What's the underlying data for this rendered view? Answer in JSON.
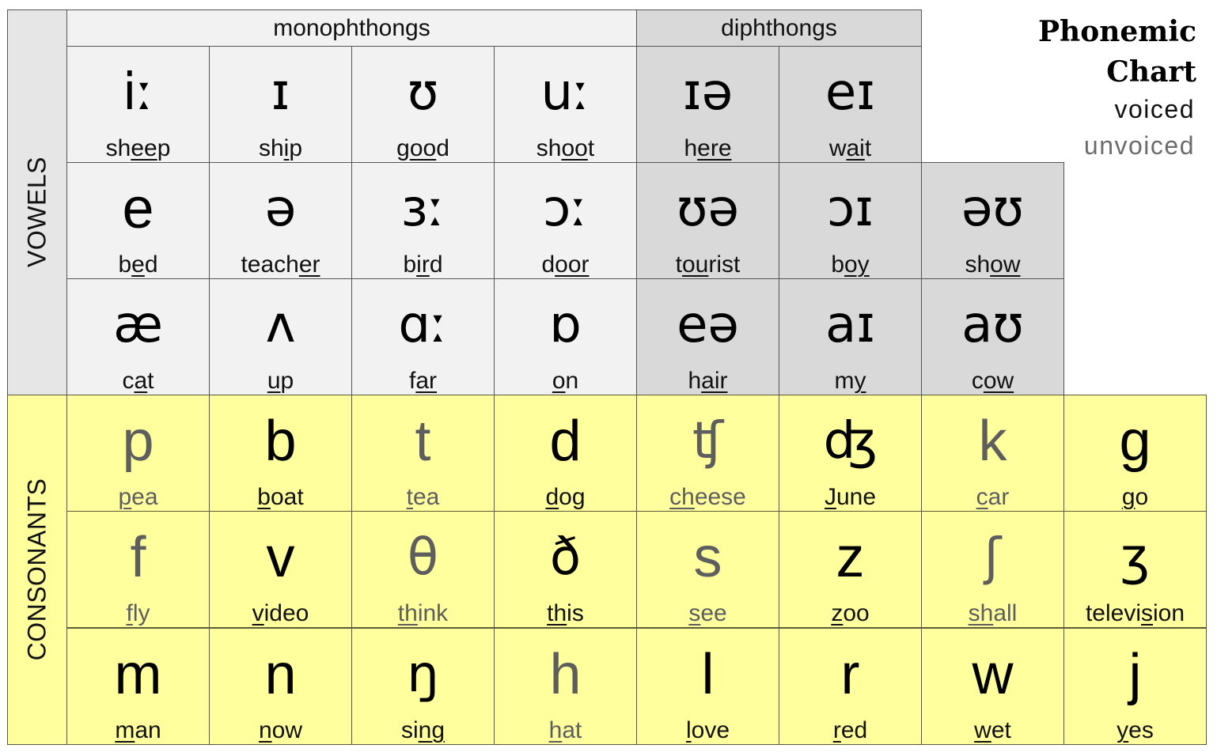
{
  "title": {
    "line1": "Phonemic",
    "line2": "Chart"
  },
  "legend": {
    "voiced": "voiced",
    "unvoiced": "unvoiced"
  },
  "colors": {
    "monophthong_bg": "#f2f2f2",
    "diphthong_bg": "#d9d9d9",
    "consonant_bg": "#ffff9e",
    "voiced_text": "#000000",
    "unvoiced_text": "#5e5e5e"
  },
  "sections": {
    "vowels": "VOWELS",
    "consonants": "CONSONANTS"
  },
  "headers": {
    "monophthongs": "monophthongs",
    "diphthongs": "diphthongs"
  },
  "vowels": [
    [
      {
        "symbol": "iː",
        "word": [
          "sh",
          "ee",
          "p"
        ],
        "type": "mono"
      },
      {
        "symbol": "ɪ",
        "word": [
          "sh",
          "i",
          "p"
        ],
        "type": "mono"
      },
      {
        "symbol": "ʊ",
        "word": [
          "g",
          "oo",
          "d"
        ],
        "type": "mono"
      },
      {
        "symbol": "uː",
        "word": [
          "sh",
          "oo",
          "t"
        ],
        "type": "mono"
      },
      {
        "symbol": "ɪə",
        "word": [
          "h",
          "ere",
          ""
        ],
        "type": "diph"
      },
      {
        "symbol": "eɪ",
        "word": [
          "w",
          "ai",
          "t"
        ],
        "type": "diph"
      }
    ],
    [
      {
        "symbol": "e",
        "word": [
          "b",
          "e",
          "d"
        ],
        "type": "mono"
      },
      {
        "symbol": "ə",
        "word": [
          "teach",
          "er",
          ""
        ],
        "type": "mono"
      },
      {
        "symbol": "ɜː",
        "word": [
          "b",
          "ir",
          "d"
        ],
        "type": "mono"
      },
      {
        "symbol": "ɔː",
        "word": [
          "d",
          "oor",
          ""
        ],
        "type": "mono"
      },
      {
        "symbol": "ʊə",
        "word": [
          "t",
          "ou",
          "rist"
        ],
        "type": "diph"
      },
      {
        "symbol": "ɔɪ",
        "word": [
          "b",
          "oy",
          ""
        ],
        "type": "diph"
      },
      {
        "symbol": "əʊ",
        "word": [
          "sh",
          "ow",
          ""
        ],
        "type": "diph"
      }
    ],
    [
      {
        "symbol": "æ",
        "word": [
          "c",
          "a",
          "t"
        ],
        "type": "mono"
      },
      {
        "symbol": "ʌ",
        "word": [
          "",
          "u",
          "p"
        ],
        "type": "mono"
      },
      {
        "symbol": "ɑː",
        "word": [
          "f",
          "ar",
          ""
        ],
        "type": "mono"
      },
      {
        "symbol": "ɒ",
        "word": [
          "",
          "o",
          "n"
        ],
        "type": "mono"
      },
      {
        "symbol": "eə",
        "word": [
          "h",
          "air",
          ""
        ],
        "type": "diph"
      },
      {
        "symbol": "aɪ",
        "word": [
          "m",
          "y",
          ""
        ],
        "type": "diph"
      },
      {
        "symbol": "aʊ",
        "word": [
          "c",
          "ow",
          ""
        ],
        "type": "diph"
      }
    ]
  ],
  "consonants": [
    [
      {
        "symbol": "p",
        "word": [
          "",
          "p",
          "ea"
        ],
        "voiced": false
      },
      {
        "symbol": "b",
        "word": [
          "",
          "b",
          "oat"
        ],
        "voiced": true
      },
      {
        "symbol": "t",
        "word": [
          "",
          "t",
          "ea"
        ],
        "voiced": false
      },
      {
        "symbol": "d",
        "word": [
          "",
          "d",
          "og"
        ],
        "voiced": true
      },
      {
        "symbol": "ʧ",
        "word": [
          "",
          "ch",
          "eese"
        ],
        "voiced": false
      },
      {
        "symbol": "ʤ",
        "word": [
          "",
          "J",
          "une"
        ],
        "voiced": true
      },
      {
        "symbol": "k",
        "word": [
          "",
          "c",
          "ar"
        ],
        "voiced": false
      },
      {
        "symbol": "g",
        "word": [
          "",
          "g",
          "o"
        ],
        "voiced": true
      }
    ],
    [
      {
        "symbol": "f",
        "word": [
          "",
          "f",
          "ly"
        ],
        "voiced": false
      },
      {
        "symbol": "v",
        "word": [
          "",
          "v",
          "ideo"
        ],
        "voiced": true
      },
      {
        "symbol": "θ",
        "word": [
          "",
          "th",
          "ink"
        ],
        "voiced": false
      },
      {
        "symbol": "ð",
        "word": [
          "",
          "th",
          "is"
        ],
        "voiced": true
      },
      {
        "symbol": "s",
        "word": [
          "",
          "s",
          "ee"
        ],
        "voiced": false
      },
      {
        "symbol": "z",
        "word": [
          "",
          "z",
          "oo"
        ],
        "voiced": true
      },
      {
        "symbol": "ʃ",
        "word": [
          "",
          "sh",
          "all"
        ],
        "voiced": false
      },
      {
        "symbol": "ʒ",
        "word": [
          "televi",
          "s",
          "ion"
        ],
        "voiced": true
      }
    ],
    [
      {
        "symbol": "m",
        "word": [
          "",
          "m",
          "an"
        ],
        "voiced": true
      },
      {
        "symbol": "n",
        "word": [
          "",
          "n",
          "ow"
        ],
        "voiced": true
      },
      {
        "symbol": "ŋ",
        "word": [
          "si",
          "ng",
          ""
        ],
        "voiced": true
      },
      {
        "symbol": "h",
        "word": [
          "",
          "h",
          "at"
        ],
        "voiced": false
      },
      {
        "symbol": "l",
        "word": [
          "",
          "l",
          "ove"
        ],
        "voiced": true
      },
      {
        "symbol": "r",
        "word": [
          "",
          "r",
          "ed"
        ],
        "voiced": true
      },
      {
        "symbol": "w",
        "word": [
          "",
          "w",
          "et"
        ],
        "voiced": true
      },
      {
        "symbol": "j",
        "word": [
          "",
          "y",
          "es"
        ],
        "voiced": true
      }
    ]
  ]
}
